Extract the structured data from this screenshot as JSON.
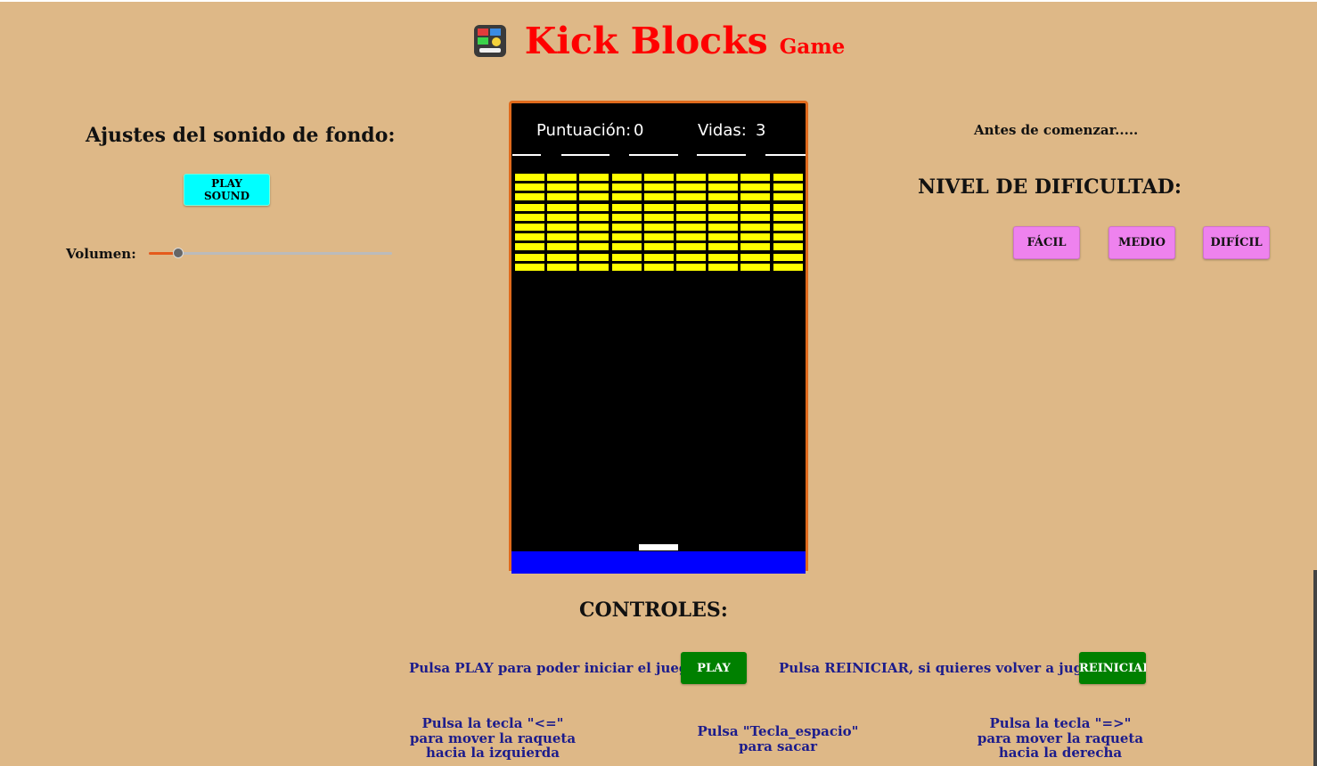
{
  "title": {
    "main": "Kick Blocks",
    "sub": "Game",
    "logo_icon": "game-logo-icon"
  },
  "sound": {
    "heading": "Ajustes del sonido de fondo:",
    "play_label": "PLAY SOUND",
    "volume_label": "Volumen:",
    "volume_value": 0.12
  },
  "game": {
    "score_label": "Puntuación:",
    "score": "0",
    "lives_label": "Vidas:",
    "lives": "3",
    "brick_rows": 10,
    "brick_cols": 9,
    "brick_color": "#ffff00",
    "floor_color": "#0000ff",
    "border_color": "#e06a1c"
  },
  "difficulty": {
    "intro": "Antes de comenzar.....",
    "heading": "NIVEL DE DIFICULTAD:",
    "levels": [
      "FÁCIL",
      "MEDIO",
      "DIFÍCIL"
    ]
  },
  "controls": {
    "heading": "CONTROLES:",
    "play_text": "Pulsa PLAY para poder iniciar el juego:",
    "play_label": "PLAY",
    "restart_text": "Pulsa REINICIAR, si quieres volver a jugar:",
    "restart_label": "REINICIAR",
    "hint_left": [
      "Pulsa la tecla \"<=\"",
      "para mover la raqueta",
      "hacia la izquierda"
    ],
    "hint_center": [
      "Pulsa \"Tecla_espacio\"",
      "para sacar"
    ],
    "hint_right": [
      "Pulsa la tecla \"=>\"",
      "para mover la raqueta",
      "hacia la derecha"
    ]
  },
  "colors": {
    "background": "#deb887",
    "title": "#ff0000",
    "cyan_button": "#00ffff",
    "level_button": "#ee82ee",
    "green_button": "#008000",
    "text_blue": "#1c1c8c"
  }
}
